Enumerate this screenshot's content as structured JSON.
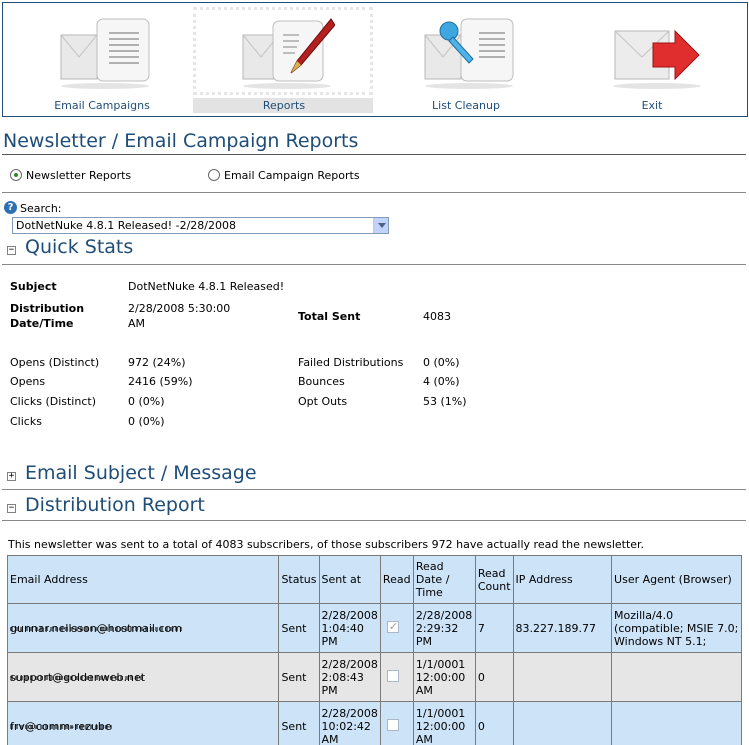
{
  "toolbar": {
    "items": [
      {
        "label": "Email Campaigns",
        "icon": "envelope-document-icon"
      },
      {
        "label": "Reports",
        "icon": "envelope-pen-icon"
      },
      {
        "label": "List Cleanup",
        "icon": "envelope-brush-icon"
      },
      {
        "label": "Exit",
        "icon": "envelope-exit-arrow-icon"
      }
    ],
    "active_index": 1
  },
  "page_title": "Newsletter / Email Campaign Reports",
  "report_type": {
    "options": [
      "Newsletter Reports",
      "Email Campaign Reports"
    ],
    "selected": "Newsletter Reports"
  },
  "search": {
    "label": "Search:",
    "selected": "DotNetNuke 4.8.1 Released! -2/28/2008"
  },
  "quick_stats": {
    "title": "Quick Stats",
    "toggle": "−",
    "subject_label": "Subject",
    "subject_value": "DotNetNuke 4.8.1 Released!",
    "dist_label_1": "Distribution",
    "dist_label_2": "Date/Time",
    "dist_value_1": "2/28/2008 5:30:00",
    "dist_value_2": "AM",
    "total_sent_label": "Total Sent",
    "total_sent_value": "4083",
    "left": [
      {
        "label": "Opens (Distinct)",
        "value": "972 (24%)"
      },
      {
        "label": "Opens",
        "value": "2416 (59%)"
      },
      {
        "label": "Clicks (Distinct)",
        "value": "0 (0%)"
      },
      {
        "label": "Clicks",
        "value": "0 (0%)"
      }
    ],
    "right": [
      {
        "label": "Failed Distributions",
        "value": "0 (0%)"
      },
      {
        "label": "Bounces",
        "value": "4 (0%)"
      },
      {
        "label": "Opt Outs",
        "value": "53 (1%)"
      }
    ]
  },
  "email_subject_section": {
    "title": "Email Subject / Message",
    "toggle": "+"
  },
  "distribution_section": {
    "title": "Distribution Report",
    "toggle": "−",
    "summary": "This newsletter was sent to a total of 4083 subscribers, of those subscribers 972 have actually read the newsletter.",
    "columns": [
      "Email Address",
      "Status",
      "Sent at",
      "Read",
      "Read Date / Time",
      "Read Count",
      "IP Address",
      "User Agent (Browser)"
    ],
    "rows": [
      {
        "email": "gunnar.nellsson@hostmail.com",
        "status": "Sent",
        "sent_at": "2/28/2008 1:04:40 PM",
        "read": true,
        "read_date": "2/28/2008 2:29:32 PM",
        "read_count": "7",
        "ip": "83.227.189.77",
        "agent": "Mozilla/4.0 (compatible; MSIE 7.0; Windows NT 5.1;"
      },
      {
        "email": "support@goldenweb.net",
        "status": "Sent",
        "sent_at": "2/28/2008 2:08:43 PM",
        "read": false,
        "read_date": "1/1/0001 12:00:00 AM",
        "read_count": "0",
        "ip": "",
        "agent": ""
      },
      {
        "email": "frv@comm-rezube",
        "status": "Sent",
        "sent_at": "2/28/2008 10:02:42 AM",
        "read": false,
        "read_date": "1/1/0001 12:00:00 AM",
        "read_count": "0",
        "ip": "",
        "agent": ""
      }
    ]
  }
}
